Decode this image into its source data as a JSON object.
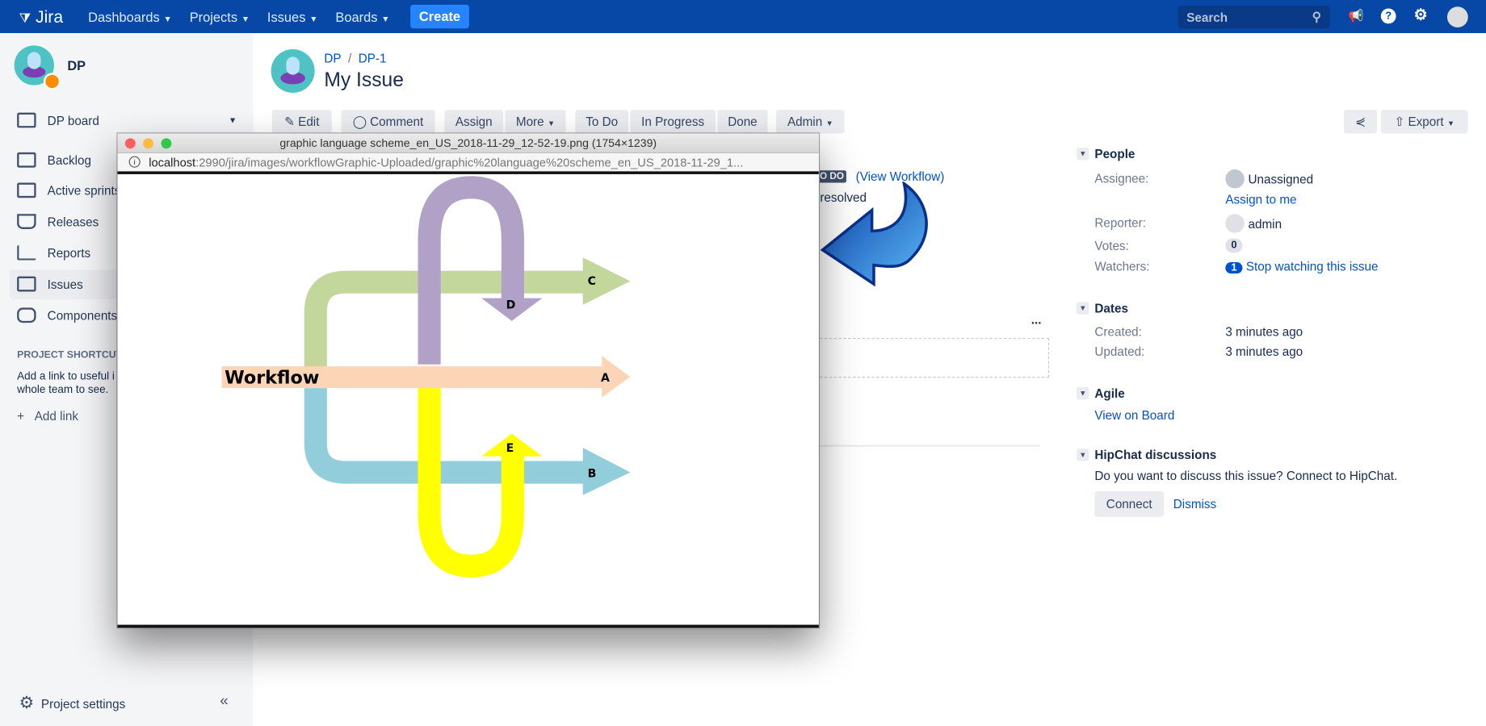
{
  "topbar": {
    "logo": "Jira",
    "nav": [
      "Dashboards",
      "Projects",
      "Issues",
      "Boards"
    ],
    "create": "Create",
    "search_placeholder": "Search",
    "brand_color": "#0747a6"
  },
  "sidebar": {
    "project": "DP",
    "board": "DP board",
    "items": [
      "Backlog",
      "Active sprints",
      "Releases",
      "Reports",
      "Issues",
      "Components"
    ],
    "selected": "Issues",
    "shortcuts_title": "PROJECT SHORTCUTS",
    "shortcuts_text_1": "Add a link to useful i",
    "shortcuts_text_2": "whole team to see.",
    "add_link": "Add link",
    "settings": "Project settings",
    "collapse": "«"
  },
  "issue": {
    "breadcrumb_project": "DP",
    "breadcrumb_key": "DP-1",
    "title": "My Issue",
    "toolbar": [
      "Edit",
      "Comment",
      "Assign",
      "More",
      "To Do",
      "In Progress",
      "Done",
      "Admin"
    ],
    "export": "Export",
    "status": "TO DO",
    "view_workflow": "(View Workflow)",
    "resolution": "nresolved",
    "more_dots": "..."
  },
  "people": {
    "header": "People",
    "assignee_label": "Assignee:",
    "assignee": "Unassigned",
    "assign_to_me": "Assign to me",
    "reporter_label": "Reporter:",
    "reporter": "admin",
    "votes_label": "Votes:",
    "votes": "0",
    "watchers_label": "Watchers:",
    "watchers": "1",
    "stop_watching": "Stop watching this issue"
  },
  "dates": {
    "header": "Dates",
    "created_label": "Created:",
    "created": "3 minutes ago",
    "updated_label": "Updated:",
    "updated": "3 minutes ago"
  },
  "agile": {
    "header": "Agile",
    "view_on_board": "View on Board"
  },
  "hipchat": {
    "header": "HipChat discussions",
    "text": "Do you want to discuss this issue? Connect to HipChat.",
    "connect": "Connect",
    "dismiss": "Dismiss"
  },
  "popup": {
    "title": "graphic language scheme_en_US_2018-11-29_12-52-19.png (1754×1239)",
    "url_host": "localhost",
    "url_rest": ":2990/jira/images/workflowGraphic-Uploaded/graphic%20language%20scheme_en_US_2018-11-29_1...",
    "diagram": {
      "main_label": "Workflow",
      "labels": [
        "A",
        "B",
        "C",
        "D",
        "E"
      ],
      "colors": {
        "main": "#fbd5b5",
        "green": "#c3d69b",
        "blue": "#92cddc",
        "purple": "#b2a1c7",
        "yellow": "#ffff00"
      }
    }
  }
}
